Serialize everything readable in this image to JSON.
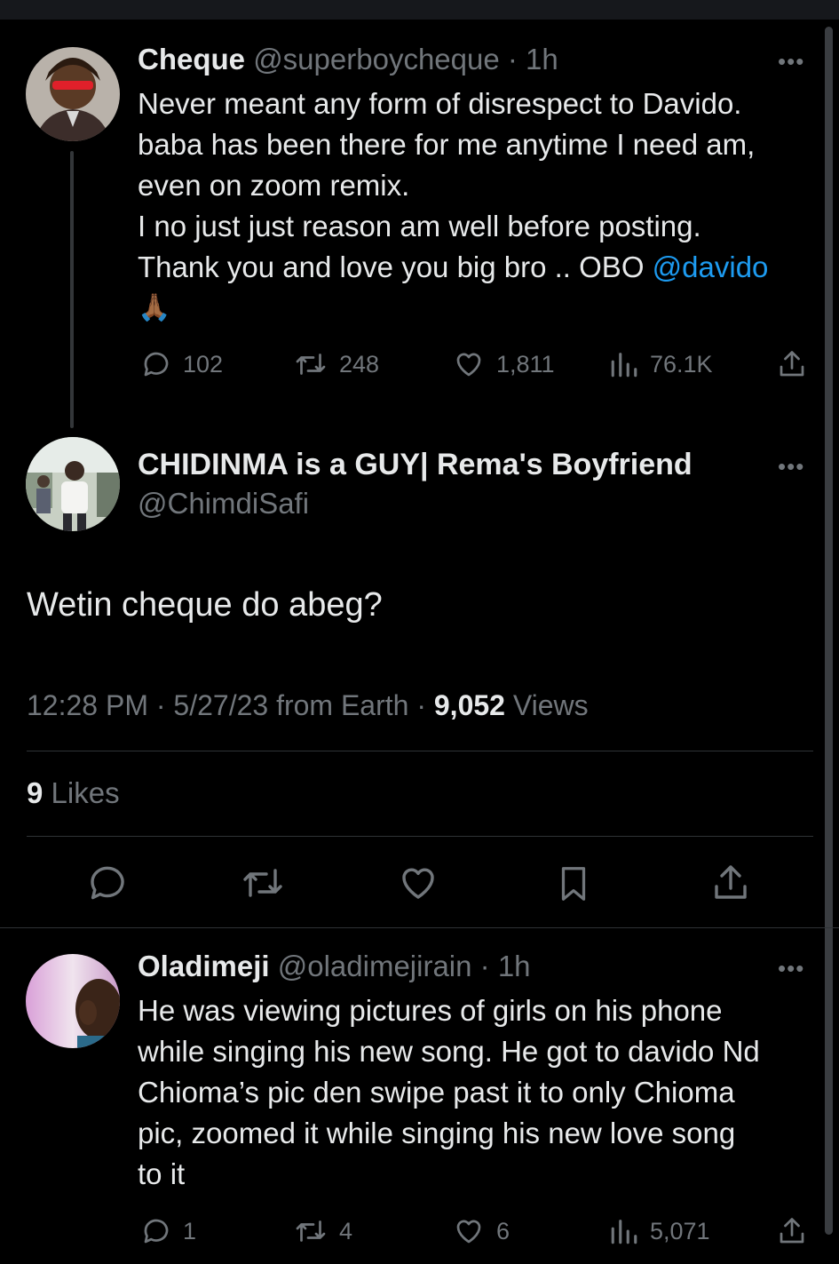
{
  "tweet1": {
    "name": "Cheque",
    "handle": "@superboycheque",
    "time": "· 1h",
    "lines": [
      "Never meant any form of disrespect to Davido.",
      "baba has been there for me anytime I need am,",
      "even on zoom remix.",
      "I no just just reason am well before posting."
    ],
    "line5_text": "Thank you and love you big bro .. OBO ",
    "mention": "@davido",
    "emoji": "🙏🏾",
    "replies": "102",
    "retweets": "248",
    "likes": "1,811",
    "views": "76.1K"
  },
  "main_tweet": {
    "name": "CHIDINMA is a GUY| Rema's Boyfriend",
    "handle": "@ChimdiSafi",
    "text": "Wetin cheque do abeg?",
    "timestamp": "12:28 PM · 5/27/23 from Earth · ",
    "views_count": "9,052",
    "views_label": " Views",
    "likes_count": "9",
    "likes_label": " Likes"
  },
  "tweet3": {
    "name": "Oladimeji",
    "handle": "@oladimejirain",
    "time": "· 1h",
    "lines": [
      "He was viewing pictures of girls on his phone",
      "while singing his new song. He got to davido Nd",
      "Chioma’s pic den swipe past it to only Chioma",
      "pic, zoomed it while singing his new love song",
      "to it"
    ],
    "replies": "1",
    "retweets": "4",
    "likes": "6",
    "views": "5,071"
  },
  "more_label": "•••",
  "colors": {
    "background": "#000000",
    "text": "#e7e9ea",
    "muted": "#71767b",
    "accent": "#1d9bf0",
    "divider": "#2f3336"
  },
  "icons": [
    "reply-icon",
    "retweet-icon",
    "like-icon",
    "views-icon",
    "share-icon",
    "bookmark-icon",
    "more-icon",
    "pray-emoji"
  ]
}
